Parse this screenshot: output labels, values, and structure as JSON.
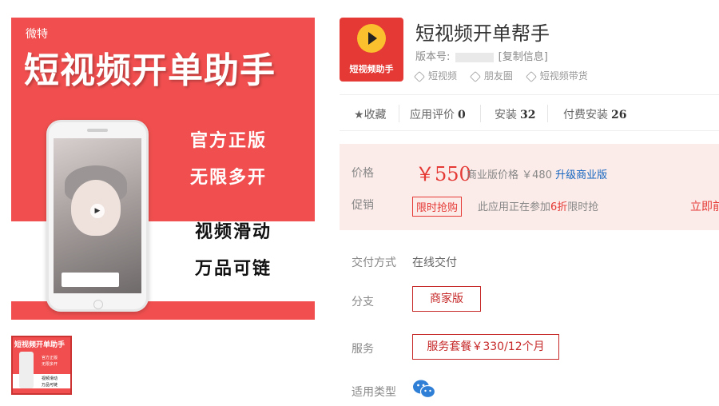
{
  "banner": {
    "brand": "微特",
    "title": "短视频开单助手",
    "slogans": [
      "官方正版",
      "无限多开",
      "视频滑动",
      "万品可链"
    ]
  },
  "thumbnail": {
    "title": "短视频开单助手",
    "lines": [
      "官方正版",
      "无限多开",
      "视频滑动",
      "万品可链"
    ]
  },
  "app": {
    "icon_label": "短视频助手",
    "title": "短视频开单帮手",
    "version_label": "版本号:",
    "copy_info": "[复制信息]",
    "tags": [
      "短视频",
      "朋友圈",
      "短视频带货"
    ]
  },
  "stats": {
    "favorite": "收藏",
    "reviews_label": "应用评价",
    "reviews": "0",
    "installs_label": "安装",
    "installs": "32",
    "paid_installs_label": "付费安装",
    "paid_installs": "26"
  },
  "pricing": {
    "price_label": "价格",
    "price": "￥550",
    "business_price_label": "商业版价格",
    "business_price": "￥480",
    "upgrade_link": "升级商业版",
    "promo_label": "促销",
    "promo_badge": "限时抢购",
    "promo_text_prefix": "此应用正在参加",
    "promo_discount": "6折",
    "promo_text_suffix": "限时抢",
    "buy_now": "立即前"
  },
  "details": {
    "delivery_label": "交付方式",
    "delivery_value": "在线交付",
    "branch_label": "分支",
    "branch_option": "商家版",
    "service_label": "服务",
    "service_option": "服务套餐￥330/12个月",
    "type_label": "适用类型"
  },
  "colors": {
    "banner_red": "#f14f4f",
    "accent_red": "#e53935",
    "price_bg": "#fbece9",
    "link_blue": "#1565c0"
  }
}
